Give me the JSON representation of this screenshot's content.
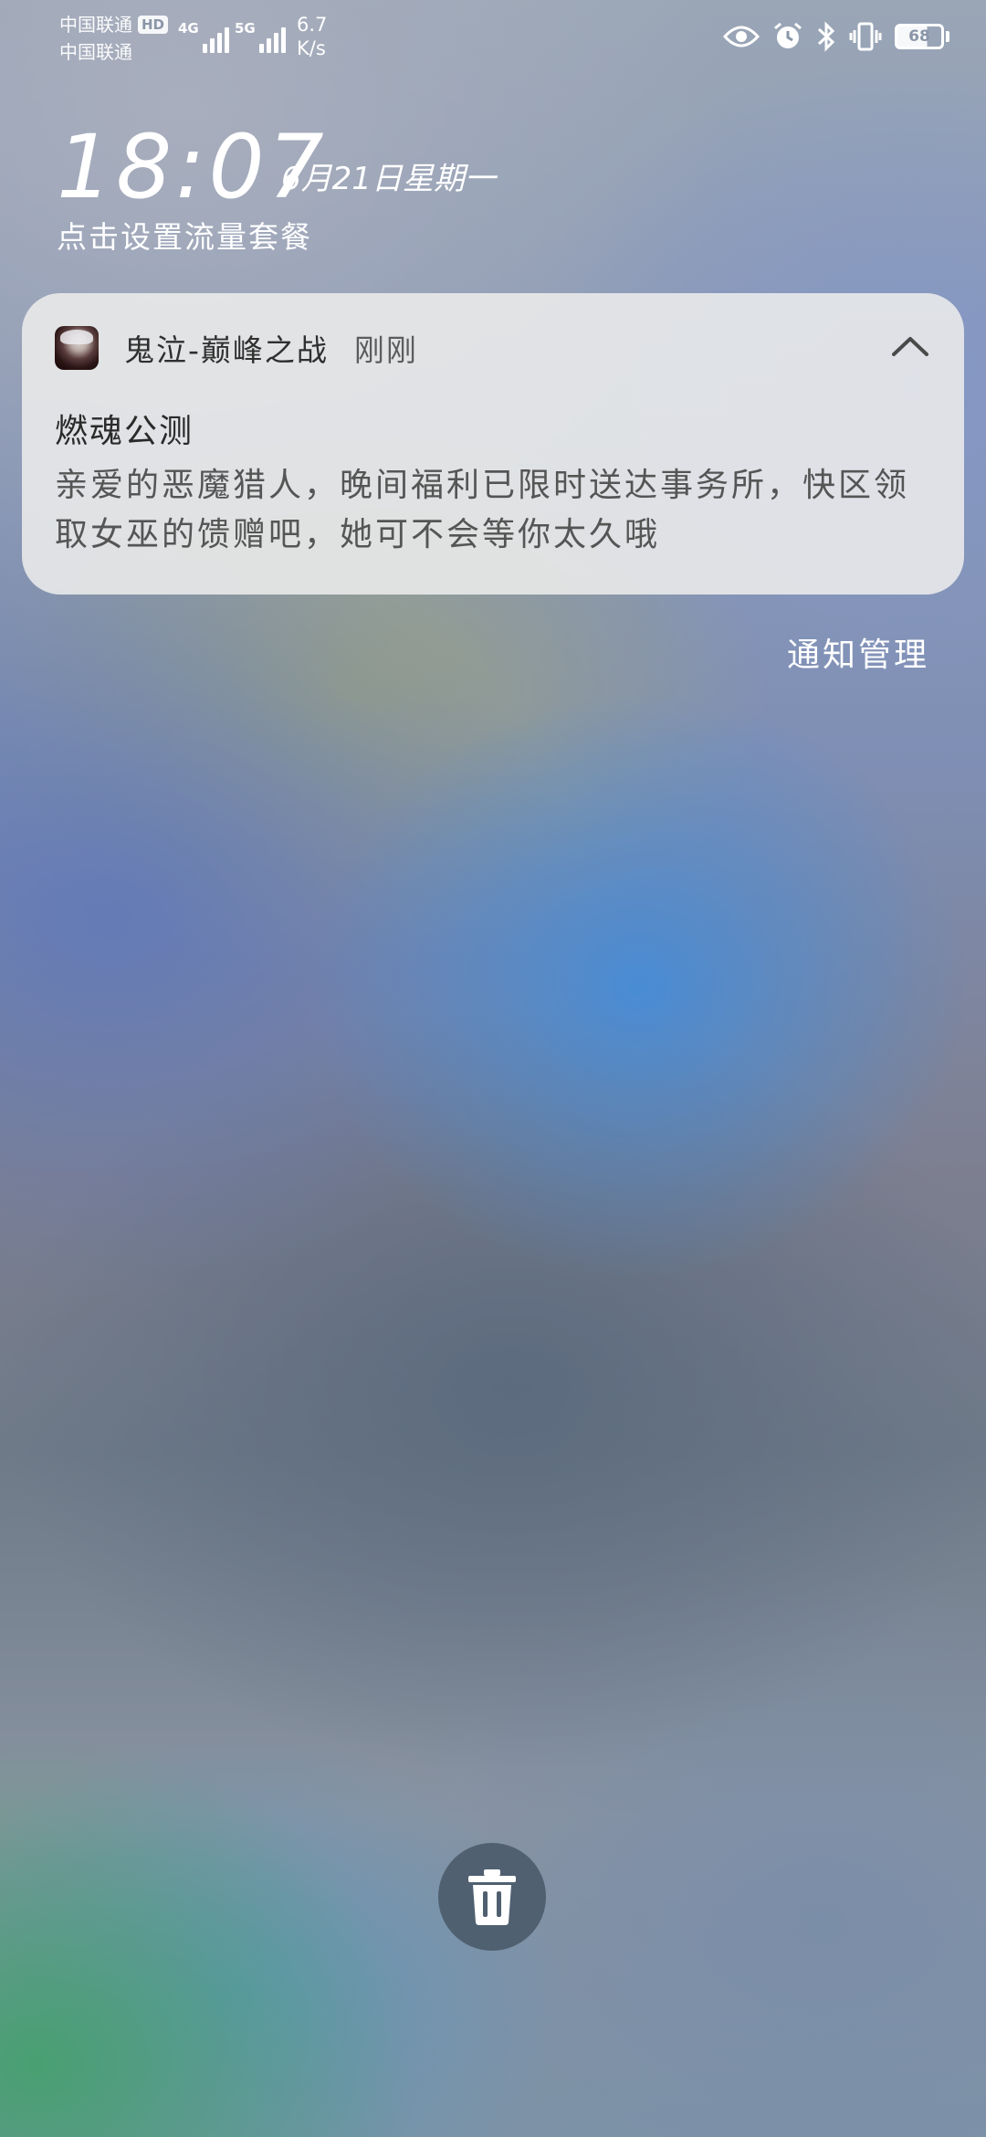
{
  "status_bar": {
    "carrier_1": "中国联通",
    "hd_badge": "HD",
    "carrier_2": "中国联通",
    "signal_1_label": "4G",
    "signal_2_label": "5G",
    "speed_value": "6.7",
    "speed_unit": "K/s",
    "battery_level": "68",
    "icons": [
      "eye-icon",
      "alarm-icon",
      "bluetooth-icon",
      "vibrate-icon",
      "battery-icon"
    ]
  },
  "lockscreen": {
    "time": "18:07",
    "date": "6月21日星期一",
    "data_plan_prompt": "点击设置流量套餐"
  },
  "notification": {
    "app_name": "鬼泣-巅峰之战",
    "time": "刚刚",
    "title": "燃魂公测",
    "body": "亲爱的恶魔猎人，晚间福利已限时送达事务所，快区领取女巫的馈赠吧，她可不会等你太久哦"
  },
  "notification_manage_label": "通知管理",
  "clear_button_icon": "trash-icon"
}
